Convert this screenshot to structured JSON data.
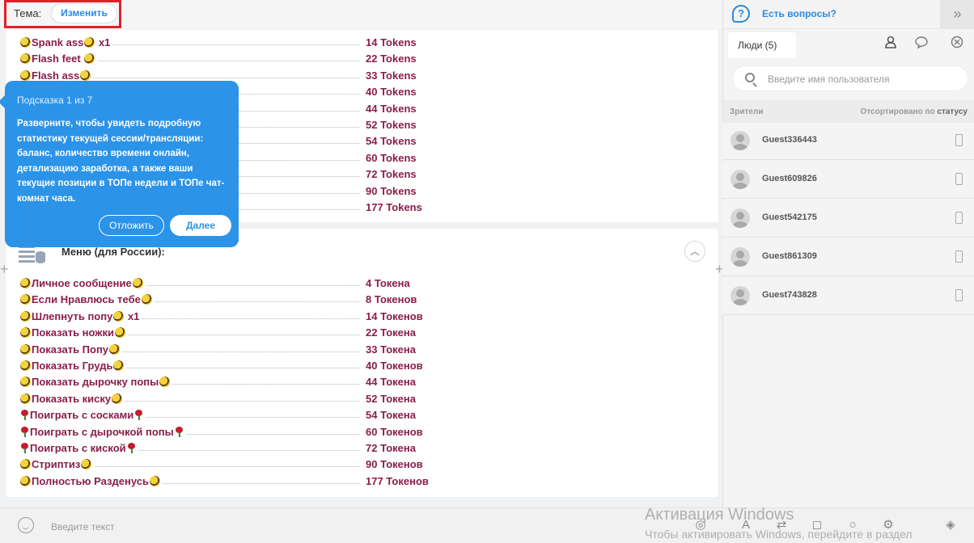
{
  "topbar": {
    "theme_label": "Тема:",
    "theme_button": "Изменить"
  },
  "menu1": {
    "items": [
      {
        "name": "Spank ass",
        "suffix": " x1",
        "price": "14 Tokens",
        "icon": "bee"
      },
      {
        "name": "Flash feet ",
        "suffix": "",
        "price": "22 Tokens",
        "icon": "bee"
      },
      {
        "name": "Flash ass",
        "suffix": "",
        "price": "33 Tokens",
        "icon": "bee"
      },
      {
        "name": "",
        "suffix": "",
        "price": "40 Tokens",
        "icon": "bee"
      },
      {
        "name": "",
        "suffix": "",
        "price": "44 Tokens",
        "icon": "bee"
      },
      {
        "name": "",
        "suffix": "",
        "price": "52 Tokens",
        "icon": "bee"
      },
      {
        "name": "",
        "suffix": "",
        "price": "54 Tokens",
        "icon": "bee"
      },
      {
        "name": "",
        "suffix": "",
        "price": "60 Tokens",
        "icon": "bee"
      },
      {
        "name": "",
        "suffix": "",
        "price": "72 Tokens",
        "icon": "bee"
      },
      {
        "name": "",
        "suffix": "",
        "price": "90 Tokens",
        "icon": "bee"
      },
      {
        "name": "",
        "suffix": "",
        "price": "177 Tokens",
        "icon": "bee"
      }
    ]
  },
  "menu2": {
    "title": "Меню (для России):",
    "items": [
      {
        "name": "Личное сообщение",
        "suffix": "",
        "price": "4 Токена",
        "icon": "bee"
      },
      {
        "name": "Если Нравлюсь тебе",
        "suffix": "",
        "price": "8 Токенов",
        "icon": "bee"
      },
      {
        "name": "Шлепнуть  попу",
        "suffix": " x1",
        "price": "14 Токенов",
        "icon": "bee"
      },
      {
        "name": "Показать ножки",
        "suffix": "",
        "price": "22 Токена",
        "icon": "bee"
      },
      {
        "name": "Показать Попу",
        "suffix": "",
        "price": "33 Токена",
        "icon": "bee"
      },
      {
        "name": "Показать Грудь",
        "suffix": "",
        "price": "40 Токенов",
        "icon": "bee"
      },
      {
        "name": "Показать дырочку попы",
        "suffix": "",
        "price": "44 Токена",
        "icon": "bee"
      },
      {
        "name": "Показать киску",
        "suffix": "",
        "price": "52 Токена",
        "icon": "bee"
      },
      {
        "name": "Поиграть с сосками",
        "suffix": "",
        "price": "54 Токена",
        "icon": "rose"
      },
      {
        "name": "Поиграть с дырочкой попы",
        "suffix": "",
        "price": "60 Токенов",
        "icon": "rose"
      },
      {
        "name": "Поиграть с киской",
        "suffix": "",
        "price": "72 Токена",
        "icon": "rose"
      },
      {
        "name": "Стриптиз",
        "suffix": "",
        "price": "90 Токенов",
        "icon": "bee"
      },
      {
        "name": "Полностью Разденусь",
        "suffix": "",
        "price": "177 Токенов",
        "icon": "bee"
      }
    ]
  },
  "tooltip": {
    "counter": "Подсказка 1 из 7",
    "text": "Разверните, чтобы увидеть подробную статистику текущей сессии/трансляции: баланс, количество времени онлайн, детализацию заработка, а также ваши текущие позиции в ТОПе недели и ТОПе чат-комнат часа.",
    "later": "Отложить",
    "next": "Далее"
  },
  "input": {
    "placeholder": "Введите текст"
  },
  "watermark": {
    "line1": "Активация Windows",
    "line2": "Чтобы активировать Windows, перейдите в раздел"
  },
  "right": {
    "help": "Есть вопросы?",
    "tab_people": "Люди",
    "tab_people_count": "(5)",
    "search_placeholder": "Введите имя пользователя",
    "viewers_label": "Зрители",
    "sort_prefix": "Отсортировано по",
    "sort_key": "статусу",
    "users": [
      "Guest336443",
      "Guest609826",
      "Guest542175",
      "Guest861309",
      "Guest743828"
    ]
  }
}
